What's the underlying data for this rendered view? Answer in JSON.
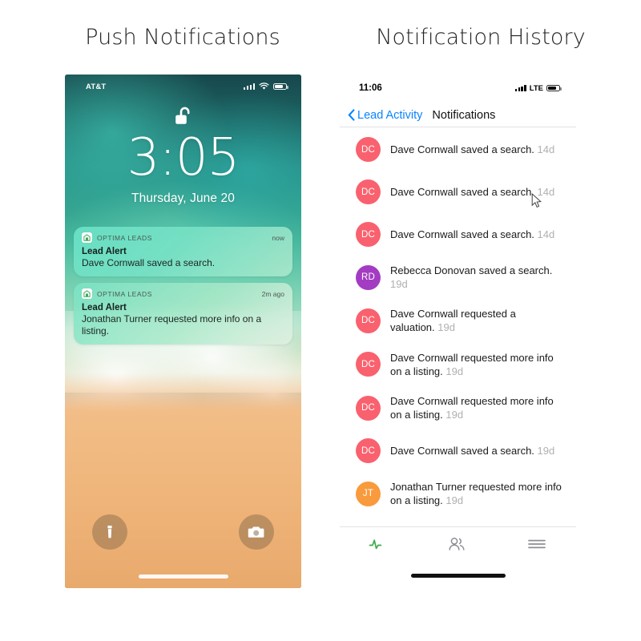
{
  "headings": {
    "left": "Push Notifications",
    "right": "Notification History"
  },
  "lockscreen": {
    "status": {
      "carrier": "AT&T",
      "signal_icon": "signal-bars-icon",
      "wifi_icon": "wifi-icon",
      "battery_icon": "battery-icon"
    },
    "lock_icon": "unlocked-padlock-icon",
    "time": "3:05",
    "date": "Thursday, June 20",
    "notifications": [
      {
        "app_icon": "optima-leads-app-icon",
        "app": "OPTIMA LEADS",
        "time": "now",
        "title": "Lead Alert",
        "body": "Dave Cornwall saved a search."
      },
      {
        "app_icon": "optima-leads-app-icon",
        "app": "OPTIMA LEADS",
        "time": "2m ago",
        "title": "Lead Alert",
        "body": "Jonathan Turner requested more info on a listing."
      }
    ],
    "controls": {
      "flashlight_icon": "flashlight-icon",
      "camera_icon": "camera-icon"
    }
  },
  "history": {
    "status": {
      "time": "11:06",
      "signal_icon": "signal-bars-icon",
      "network": "LTE",
      "battery_icon": "battery-icon"
    },
    "nav": {
      "back_icon": "chevron-left-icon",
      "back_label": "Lead Activity",
      "title": "Notifications"
    },
    "rows": [
      {
        "initials": "DC",
        "color": "#f9616e",
        "text": "Dave Cornwall saved a search.",
        "time": "14d"
      },
      {
        "initials": "DC",
        "color": "#f9616e",
        "text": "Dave Cornwall saved a search.",
        "time": "14d"
      },
      {
        "initials": "DC",
        "color": "#f9616e",
        "text": "Dave Cornwall saved a search.",
        "time": "14d"
      },
      {
        "initials": "RD",
        "color": "#a33cc2",
        "text": "Rebecca Donovan saved a search.",
        "time": "19d"
      },
      {
        "initials": "DC",
        "color": "#f9616e",
        "text": "Dave Cornwall requested a valuation.",
        "time": "19d"
      },
      {
        "initials": "DC",
        "color": "#f9616e",
        "text": "Dave Cornwall requested more info on a listing.",
        "time": "19d"
      },
      {
        "initials": "DC",
        "color": "#f9616e",
        "text": "Dave Cornwall requested more info on a listing.",
        "time": "19d"
      },
      {
        "initials": "DC",
        "color": "#f9616e",
        "text": "Dave Cornwall saved a search.",
        "time": "19d"
      },
      {
        "initials": "JT",
        "color": "#f99a3c",
        "text": "Jonathan Turner requested more info on a listing.",
        "time": "19d"
      }
    ],
    "tabs": [
      {
        "icon": "activity-pulse-icon",
        "active": true,
        "color": "#3faa4a"
      },
      {
        "icon": "people-icon",
        "active": false,
        "color": "#8e8e93"
      },
      {
        "icon": "hamburger-menu-icon",
        "active": false,
        "color": "#8e8e93"
      }
    ]
  },
  "colors": {
    "link_blue": "#0a84ff",
    "avatar_red": "#f9616e",
    "avatar_purple": "#a33cc2",
    "avatar_orange": "#f99a3c",
    "tab_active_green": "#3faa4a",
    "timestamp_gray": "#b0b0b3"
  }
}
